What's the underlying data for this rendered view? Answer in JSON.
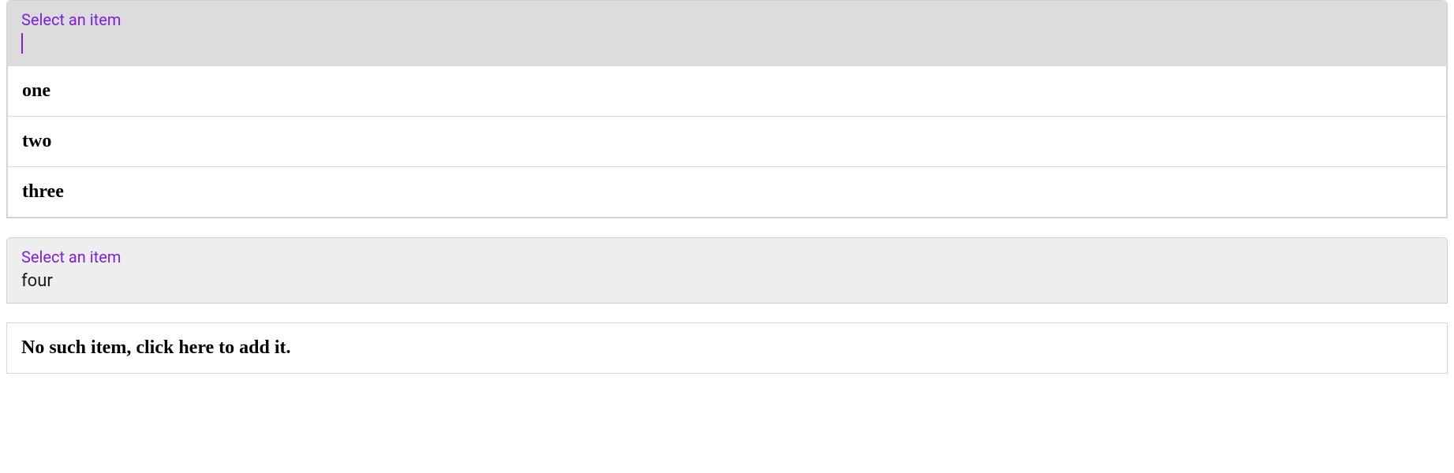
{
  "select1": {
    "label": "Select an item",
    "value": "",
    "options": [
      "one",
      "two",
      "three"
    ]
  },
  "select2": {
    "label": "Select an item",
    "value": "four",
    "add_prompt": "No such item, click here to add it."
  }
}
